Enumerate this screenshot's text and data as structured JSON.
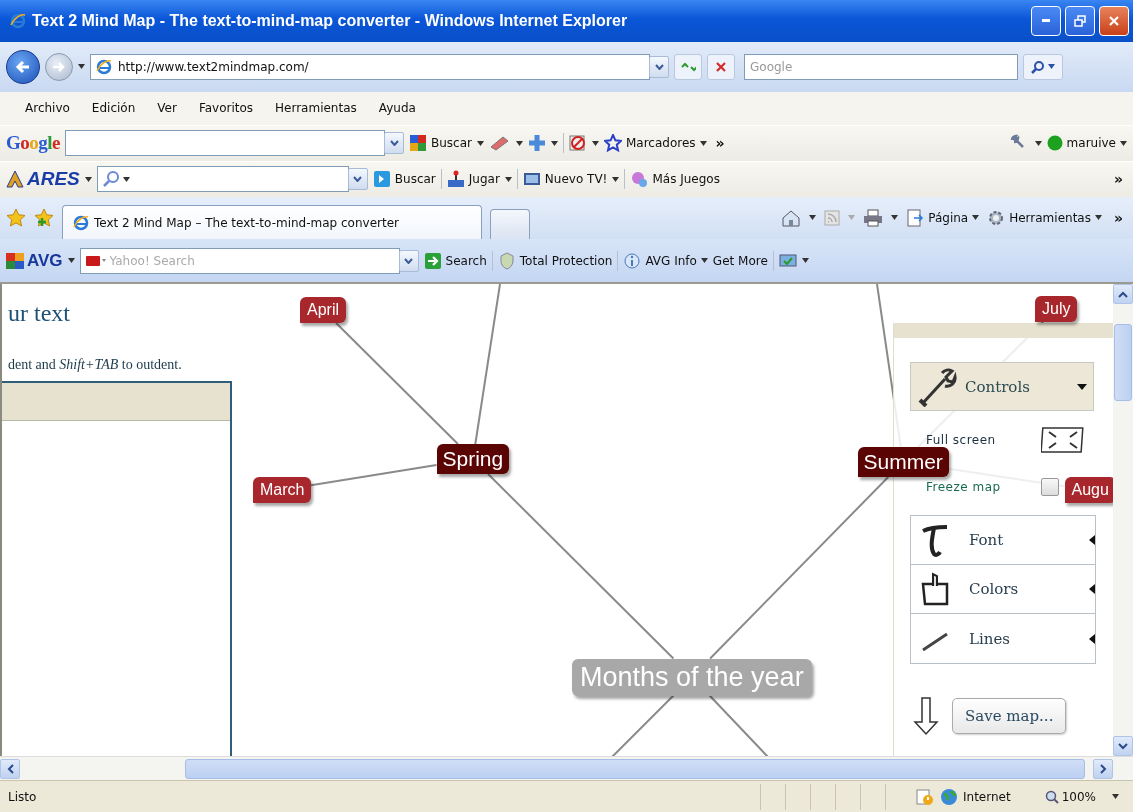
{
  "window": {
    "title": "Text 2 Mind Map - The text-to-mind-map converter - Windows Internet Explorer"
  },
  "address_bar": {
    "url": "http://www.text2mindmap.com/",
    "search_placeholder": "Google"
  },
  "menu": [
    "Archivo",
    "Edición",
    "Ver",
    "Favoritos",
    "Herramientas",
    "Ayuda"
  ],
  "google_toolbar": {
    "logo": "Google",
    "search_label": "Buscar",
    "bookmarks_label": "Marcadores",
    "overflow": "»",
    "user": "maruive"
  },
  "ares_toolbar": {
    "logo": "ARES",
    "items": [
      "Buscar",
      "Jugar",
      "Nuevo TV!",
      "Más Juegos"
    ],
    "overflow": "»"
  },
  "tabs": [
    {
      "label": "Text 2 Mind Map – The text-to-mind-map converter",
      "selected": true
    }
  ],
  "command_bar": {
    "items": [
      "Página",
      "Herramientas"
    ],
    "overflow": "»"
  },
  "avg_toolbar": {
    "logo": "AVG",
    "search_placeholder": "Yahoo! Search",
    "items": [
      "Search",
      "Total Protection",
      "AVG Info",
      "Get More"
    ]
  },
  "page": {
    "heading": "ur text",
    "hint": "dent and *Shift+TAB* to outdent.",
    "mind_map": {
      "label": "Months of the year",
      "children": [
        {
          "label": "Spring",
          "children": [
            {
              "label": "April"
            },
            {
              "label": "March"
            }
          ]
        },
        {
          "label": "Summer",
          "children": [
            {
              "label": "July"
            },
            {
              "label": "Augu"
            }
          ]
        }
      ]
    },
    "panel": {
      "controls": {
        "label": "Controls",
        "expanded": true
      },
      "full_screen": "Full screen",
      "freeze": {
        "label": "Freeze map",
        "checked": false
      },
      "sections": [
        {
          "kind": "font",
          "label": "Font"
        },
        {
          "kind": "colors",
          "label": "Colors"
        },
        {
          "kind": "lines",
          "label": "Lines"
        }
      ],
      "save": "Save map..."
    }
  },
  "status_bar": {
    "text": "Listo",
    "zone": "Internet",
    "zoom": "100%"
  }
}
